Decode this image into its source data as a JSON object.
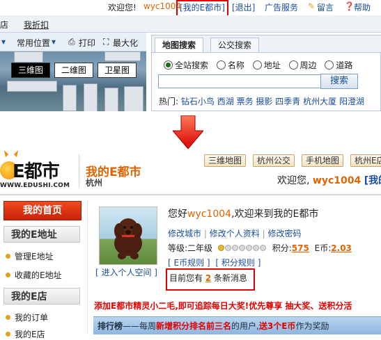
{
  "top_bar": {
    "welcome": "欢迎您!",
    "username": "wyc1004",
    "my_edushi": "[我的E都市]",
    "logout": "[退出]",
    "ad_service": "广告服务",
    "message": "留言",
    "help": "帮助"
  },
  "nav_row": {
    "left_cut": "店",
    "find_discount": "我折扣"
  },
  "map_toolbar": {
    "common_locations": "常用位置",
    "print": "打印",
    "maximize": "最大化",
    "watermark": "E都",
    "view_modes": [
      "三维图",
      "二维图",
      "卫星图"
    ],
    "active_view": 0
  },
  "search_panel": {
    "tabs": [
      "地图搜索",
      "公交搜索"
    ],
    "scope_options": [
      "全站搜索",
      "名称",
      "地址",
      "周边",
      "道路"
    ],
    "selected_scope": 0,
    "input_value": "",
    "search_button": "搜索",
    "hot_label": "热门:",
    "hot_terms": [
      "钻石小鸟",
      "西湖",
      "票务",
      "摄影",
      "四季青",
      "杭州大厦",
      "阳澄湖"
    ]
  },
  "header": {
    "logo_text": "E都市",
    "logo_url": "WWW.EDUSHI.COM",
    "site_name": "我的E都市",
    "city": "杭州",
    "quick_links": [
      "三维地图",
      "杭州公交",
      "手机地图",
      "杭州E店"
    ],
    "welcome_prefix": "欢迎您,",
    "username": "wyc1004",
    "welcome_tail": "[我的"
  },
  "sidebar": {
    "home": "我的首页",
    "sections": [
      {
        "title": "我的E地址",
        "items": [
          "管理E地址",
          "收藏的E地址"
        ]
      },
      {
        "title": "我的E店",
        "items": [
          "我的订单",
          "我的E店"
        ]
      }
    ]
  },
  "profile": {
    "enter_space": "[ 进入个人空间 ]",
    "greeting_prefix": "您好",
    "username": "wyc1004",
    "greeting_suffix": ",欢迎来到我的E都市",
    "links": [
      "修改城市",
      "修改个人资料",
      "修改密码"
    ],
    "level_label": "等级:二年级",
    "level_dots_filled": 1,
    "level_dots_total": 7,
    "points_label": "积分:",
    "points_value": "575",
    "ecoin_label": "E币:",
    "ecoin_value": "2.03",
    "rule_links": [
      "[ E币规则 ]",
      "[ 积分规则 ]"
    ],
    "msg_prefix": "目前您有",
    "msg_count": "2",
    "msg_suffix": "条新消息"
  },
  "promo": {
    "text": "添加E都市精灵小二毛,即可追踪每日大奖!优先尊享 抽大奖、送积分活"
  },
  "rank": {
    "title": "排行榜",
    "dash": "——",
    "text1": "每周",
    "highlight1": "新增积分排名前三名",
    "text2": "的用户,",
    "highlight2": "送3个E币",
    "text3": "作为奖励"
  },
  "colors": {
    "red_highlight": "#e00000",
    "brand_orange": "#e06400",
    "link_blue": "#1a4e9b"
  }
}
